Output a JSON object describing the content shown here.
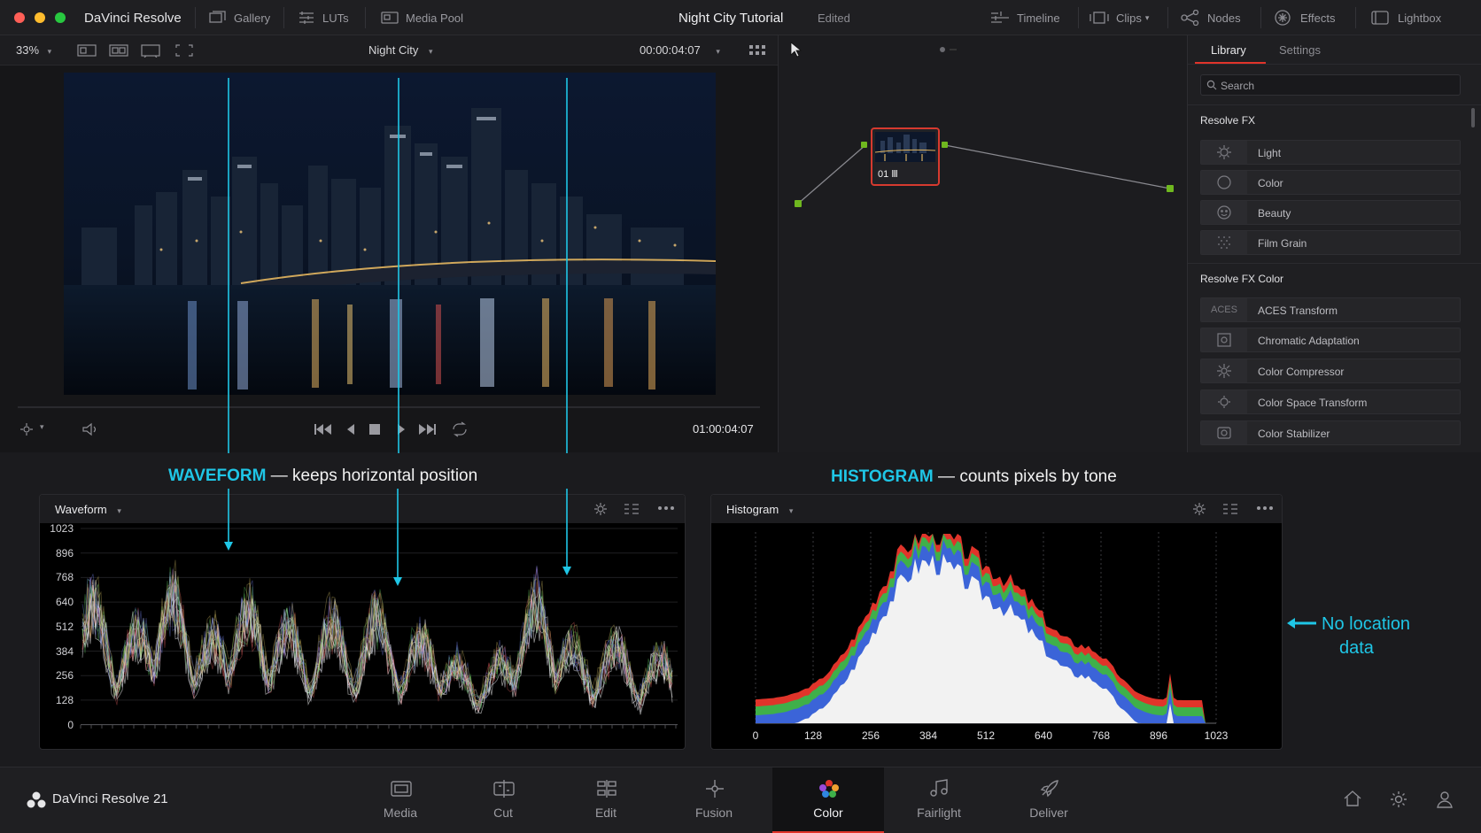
{
  "app": {
    "name": "DaVinci Resolve"
  },
  "titlebar": {
    "items": [
      {
        "label": "Gallery",
        "icon": "gallery-icon"
      },
      {
        "label": "LUTs",
        "icon": "luts-icon"
      },
      {
        "label": "Media Pool",
        "icon": "media-pool-icon"
      }
    ],
    "project_title": "Night City Tutorial",
    "project_status": "Edited",
    "right_items": [
      {
        "label": "Timeline",
        "icon": "timeline-icon"
      },
      {
        "label": "Clips",
        "icon": "clips-icon"
      },
      {
        "label": "Nodes",
        "icon": "nodes-icon"
      },
      {
        "label": "Effects",
        "icon": "effects-icon"
      },
      {
        "label": "Lightbox",
        "icon": "lightbox-icon"
      }
    ]
  },
  "viewer": {
    "zoom": "33%",
    "clip_name": "Night City",
    "timecode_top": "00:00:04:07",
    "timecode_bottom": "01:00:04:07"
  },
  "node_editor": {
    "node_label": "01 Ⅲ"
  },
  "library": {
    "tabs": [
      {
        "label": "Library",
        "active": true
      },
      {
        "label": "Settings",
        "active": false
      }
    ],
    "search_placeholder": "Search",
    "sections": [
      {
        "title": "Resolve FX",
        "items": [
          {
            "label": "Light",
            "icon": "light-icon"
          },
          {
            "label": "Color",
            "icon": "color-icon"
          },
          {
            "label": "Beauty",
            "icon": "beauty-icon"
          },
          {
            "label": "Film Grain",
            "icon": "film-grain-icon"
          }
        ]
      },
      {
        "title": "Resolve FX Color",
        "items": [
          {
            "label": "ACES Transform",
            "icon_text": "ACES"
          },
          {
            "label": "Chromatic Adaptation",
            "icon": "chromatic-adaptation-icon"
          },
          {
            "label": "Color Compressor",
            "icon": "color-compressor-icon"
          },
          {
            "label": "Color Space Transform",
            "icon": "color-space-transform-icon"
          },
          {
            "label": "Color Stabilizer",
            "icon": "color-stabilizer-icon"
          }
        ]
      }
    ]
  },
  "annotations": {
    "waveform_headline_bold": "WAVEFORM",
    "waveform_headline_rest": "— keeps horizontal position",
    "histogram_headline_bold": "HISTOGRAM",
    "histogram_headline_rest": "— counts pixels by tone",
    "note_line1": "No location",
    "note_line2": "data"
  },
  "waveform": {
    "title": "Waveform",
    "y_ticks": [
      "1023",
      "896",
      "768",
      "640",
      "512",
      "384",
      "256",
      "128",
      "0"
    ]
  },
  "histogram": {
    "title": "Histogram",
    "x_ticks": [
      "0",
      "128",
      "256",
      "384",
      "512",
      "640",
      "768",
      "896",
      "1023"
    ]
  },
  "pagebar": {
    "brand": "DaVinci Resolve 21",
    "pages": [
      {
        "label": "Media",
        "icon": "media-page-icon"
      },
      {
        "label": "Cut",
        "icon": "cut-page-icon"
      },
      {
        "label": "Edit",
        "icon": "edit-page-icon"
      },
      {
        "label": "Fusion",
        "icon": "fusion-page-icon"
      },
      {
        "label": "Color",
        "icon": "color-page-icon",
        "active": true
      },
      {
        "label": "Fairlight",
        "icon": "fairlight-page-icon"
      },
      {
        "label": "Deliver",
        "icon": "deliver-page-icon"
      }
    ]
  },
  "colors": {
    "accent": "#1fc6e6",
    "active_page": "#e0342a",
    "node_border": "#d63a2f",
    "node_port": "#6fb81f"
  }
}
